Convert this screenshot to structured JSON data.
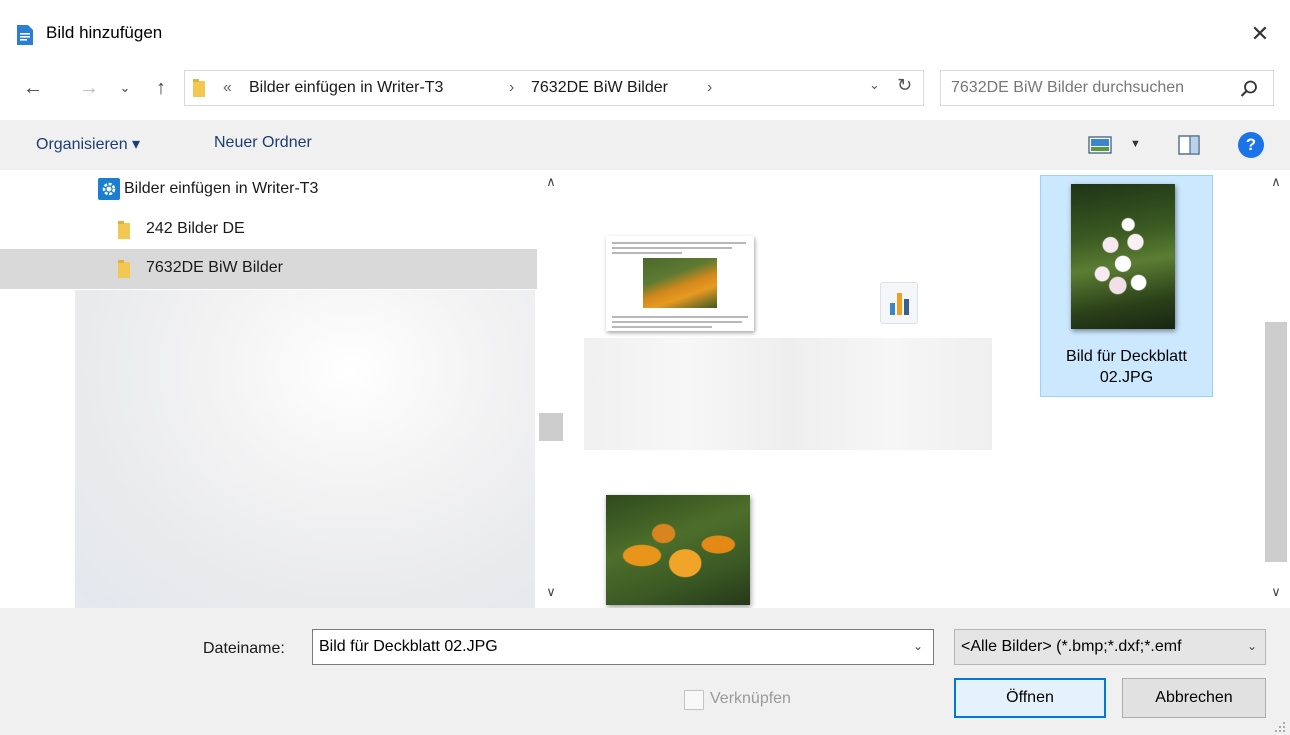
{
  "window": {
    "title": "Bild hinzufügen",
    "close_glyph": "✕"
  },
  "nav": {
    "back_glyph": "←",
    "forward_glyph": "→",
    "recent_glyph": "⌄",
    "up_glyph": "↑"
  },
  "address": {
    "chevrons": "«",
    "segments": [
      "Bilder einfügen in Writer-T3",
      "7632DE BiW Bilder"
    ],
    "separator": "›",
    "dropdown_glyph": "⌄",
    "refresh_glyph": "↻"
  },
  "search": {
    "placeholder": "7632DE BiW Bilder durchsuchen"
  },
  "toolbar": {
    "organize_label": "Organisieren ▾",
    "new_folder_label": "Neuer Ordner",
    "view_dropdown_glyph": "▼",
    "help_label": "?"
  },
  "sidebar": {
    "items": [
      {
        "label": "Bilder einfügen in Writer-T3",
        "icon": "gear-box-icon"
      },
      {
        "label": "242 Bilder DE",
        "icon": "folder-icon"
      },
      {
        "label": "7632DE BiW Bilder",
        "icon": "folder-icon",
        "selected": true
      }
    ],
    "scroll_up_glyph": "∧",
    "scroll_down_glyph": "∨"
  },
  "files": {
    "selected_label": "Bild für Deckblatt 02.JPG",
    "scroll_up_glyph": "∧",
    "scroll_down_glyph": "∨"
  },
  "bottom": {
    "filename_label": "Dateiname:",
    "filename_value": "Bild für Deckblatt 02.JPG",
    "dropdown_glyph": "⌄",
    "filetype_value": "<Alle Bilder> (*.bmp;*.dxf;*.emf",
    "link_label": "Verknüpfen",
    "open_label": "Öffnen",
    "cancel_label": "Abbrechen"
  },
  "colors": {
    "accent": "#0078d7",
    "selection": "#cce8ff",
    "toolbar_bg": "#f0f0f0",
    "folder": "#f3c850",
    "help": "#1a73e8"
  }
}
